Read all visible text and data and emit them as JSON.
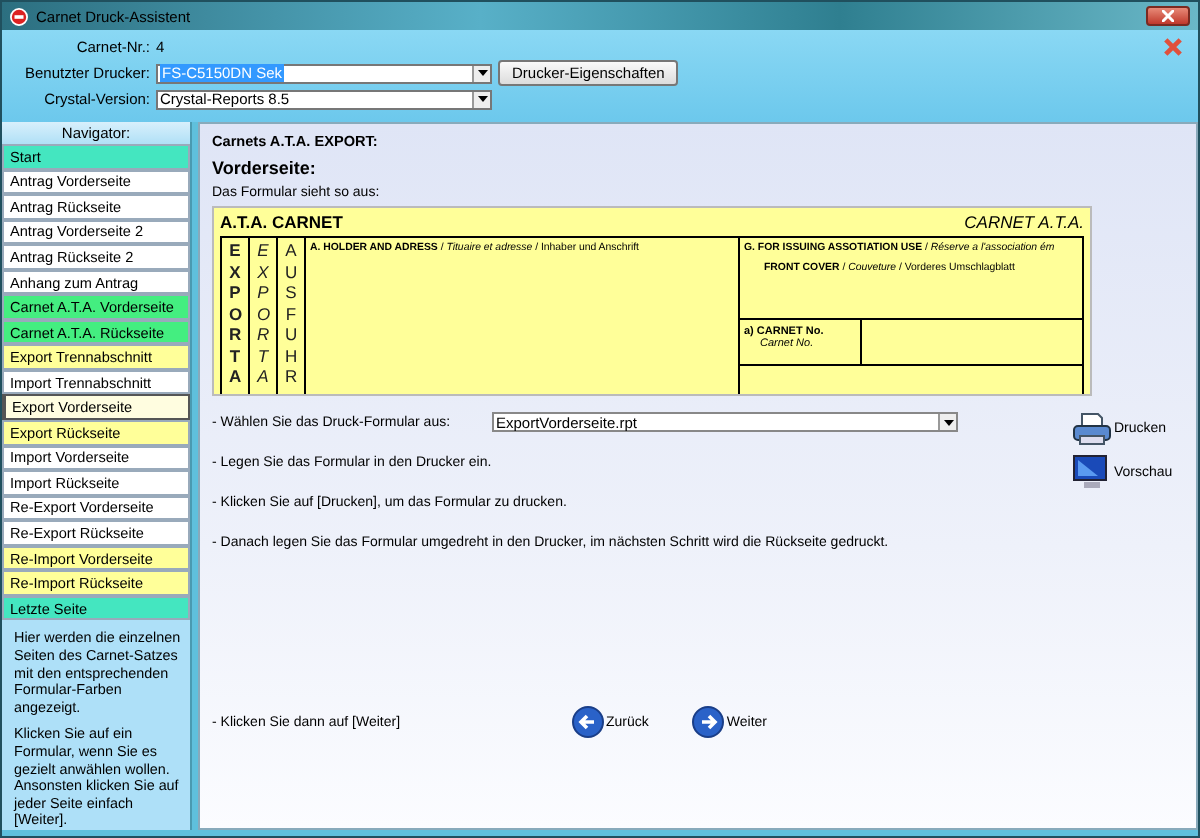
{
  "window": {
    "title": "Carnet Druck-Assistent"
  },
  "header": {
    "carnet_label": "Carnet-Nr.:",
    "carnet_value": "4",
    "printer_label": "Benutzter Drucker:",
    "printer_value": "FS-C5150DN Sek",
    "printer_button": "Drucker-Eigenschaften",
    "crystal_label": "Crystal-Version:",
    "crystal_value": "Crystal-Reports 8.5"
  },
  "navigator": {
    "title": "Navigator:",
    "items": [
      {
        "label": "Start",
        "color": "#44e6c0",
        "selected": false
      },
      {
        "label": "Antrag Vorderseite",
        "color": "#ffffff",
        "selected": false
      },
      {
        "label": "Antrag Rückseite",
        "color": "#ffffff",
        "selected": false
      },
      {
        "label": "Antrag Vorderseite 2",
        "color": "#ffffff",
        "selected": false
      },
      {
        "label": "Antrag Rückseite 2",
        "color": "#ffffff",
        "selected": false
      },
      {
        "label": "Anhang zum Antrag",
        "color": "#ffffff",
        "selected": false
      },
      {
        "label": "Carnet A.T.A. Vorderseite",
        "color": "#44ee80",
        "selected": false
      },
      {
        "label": "Carnet A.T.A. Rückseite",
        "color": "#44ee80",
        "selected": false
      },
      {
        "label": "Export Trennabschnitt",
        "color": "#ffff99",
        "selected": false
      },
      {
        "label": "Import Trennabschnitt",
        "color": "#ffffff",
        "selected": false
      },
      {
        "label": "Export Vorderseite",
        "color": "#fffde0",
        "selected": true
      },
      {
        "label": "Export Rückseite",
        "color": "#ffff99",
        "selected": false
      },
      {
        "label": "Import Vorderseite",
        "color": "#ffffff",
        "selected": false
      },
      {
        "label": "Import Rückseite",
        "color": "#ffffff",
        "selected": false
      },
      {
        "label": "Re-Export Vorderseite",
        "color": "#ffffff",
        "selected": false
      },
      {
        "label": "Re-Export Rückseite",
        "color": "#ffffff",
        "selected": false
      },
      {
        "label": "Re-Import Vorderseite",
        "color": "#ffff99",
        "selected": false
      },
      {
        "label": "Re-Import Rückseite",
        "color": "#ffff99",
        "selected": false
      },
      {
        "label": "Letzte Seite",
        "color": "#44e6c0",
        "selected": false
      }
    ],
    "help": [
      "Hier werden die einzelnen Seiten des Carnet-Satzes mit den entsprechenden Formular-Farben angezeigt.",
      "Klicken Sie auf ein Formular, wenn Sie es gezielt anwählen wollen. Ansonsten klicken Sie auf jeder Seite einfach [Weiter]."
    ]
  },
  "content": {
    "section": "Carnets A.T.A. EXPORT:",
    "page_title": "Vorderseite:",
    "intro": "Das Formular sieht so aus:",
    "form": {
      "title": "A.T.A. CARNET",
      "title_fr": "CARNET A.T.A.",
      "column_1": "EXPORTA",
      "column_2": "EXPORTA",
      "column_3": "AUSFUHR",
      "holder": "**A. HOLDER AND ADRESS** / *Tituaire et adresse* / Inhaber und Anschrift",
      "issuing": "**G. FOR ISSUING ASSOTIATION USE** / *Réserve a l'association ém*",
      "front_cover": "**FRONT COVER** / *Couveture* / Vorderes Umschlagblatt",
      "carnet_no": "a) CARNET No.",
      "carnet_no_fr": "Carnet No."
    },
    "steps": [
      {
        "kind": "select",
        "text": "- Wählen Sie das Druck-Formular aus:",
        "value": "ExportVorderseite.rpt"
      },
      {
        "kind": "text",
        "text": "- Legen Sie das Formular in den Drucker ein."
      },
      {
        "kind": "text",
        "text": "- Klicken Sie auf [Drucken], um das Formular zu drucken."
      },
      {
        "kind": "text",
        "text": "- Danach legen Sie das Formular umgedreht in den Drucker, im nächsten Schritt wird die Rückseite gedruckt."
      }
    ],
    "actions": [
      {
        "kind": "printer",
        "label": "Drucken"
      },
      {
        "kind": "monitor",
        "label": "Vorschau"
      }
    ],
    "final_step": "- Klicken Sie dann auf [Weiter]",
    "nav_buttons": [
      {
        "kind": "back",
        "label": "Zurück"
      },
      {
        "kind": "next",
        "label": "Weiter"
      }
    ]
  }
}
